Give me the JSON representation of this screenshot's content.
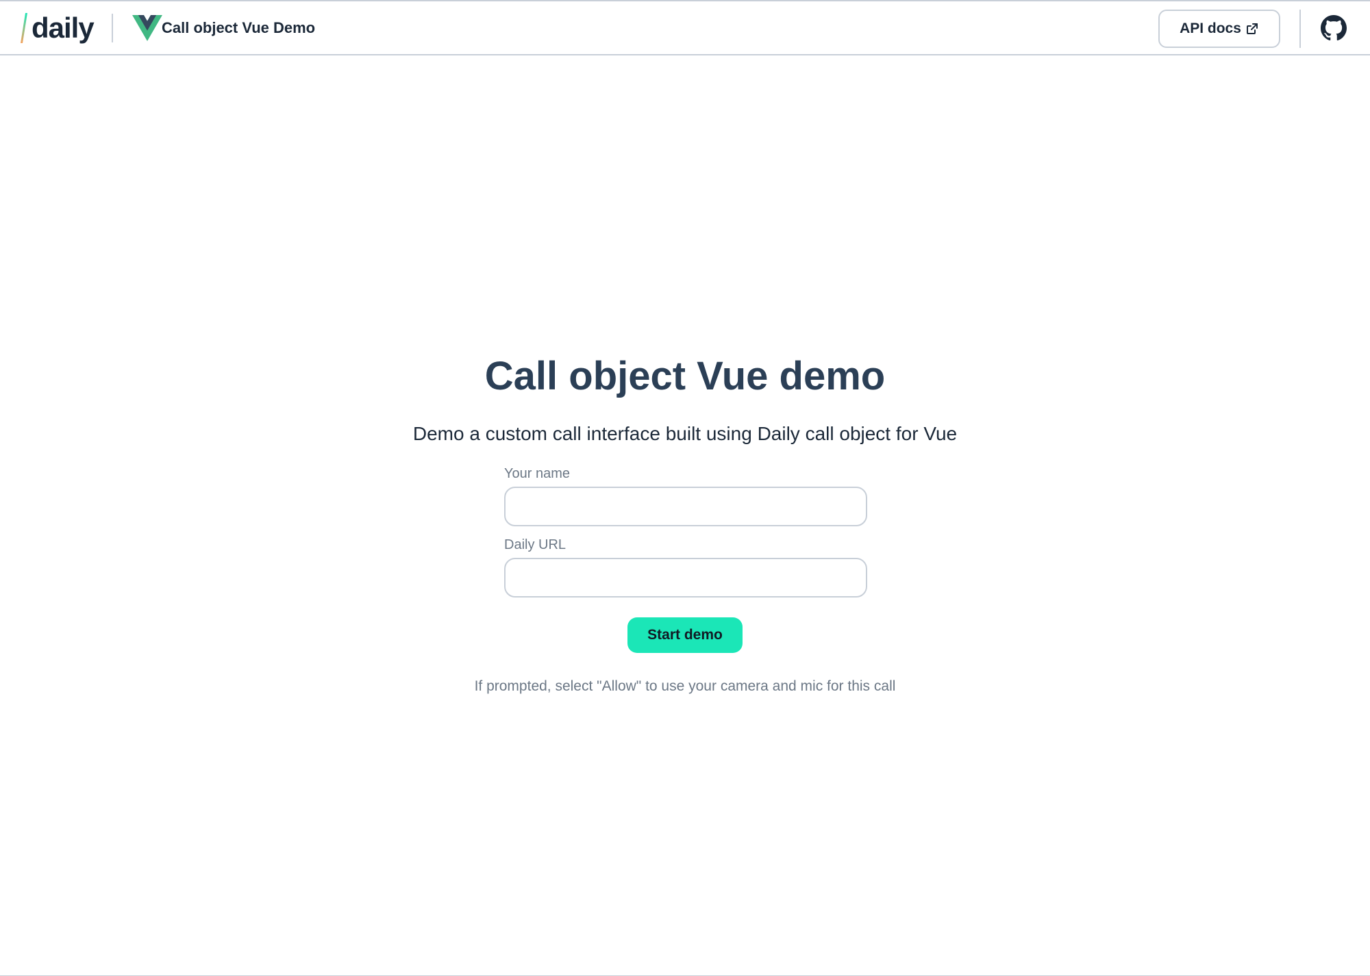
{
  "header": {
    "logo_text": "daily",
    "app_title": "Call object Vue Demo",
    "api_docs_label": "API docs",
    "icons": {
      "external_link": "external-link-icon",
      "github": "github-icon",
      "vue": "vue-logo-icon"
    }
  },
  "main": {
    "title": "Call object Vue demo",
    "subtitle": "Demo a custom call interface built using Daily call object for Vue",
    "form": {
      "name_label": "Your name",
      "name_value": "",
      "url_label": "Daily URL",
      "url_value": "",
      "submit_label": "Start demo"
    },
    "note": "If prompted, select \"Allow\" to use your camera and mic for this call"
  },
  "colors": {
    "accent": "#1be6b7",
    "text_dark": "#2b3f56",
    "text_muted": "#6b7785",
    "border": "#c8cfd8",
    "logo_slash_top": "#1be6b7",
    "logo_slash_bottom": "#f5a25d",
    "vue_green": "#41b883",
    "vue_dark": "#35495e"
  }
}
